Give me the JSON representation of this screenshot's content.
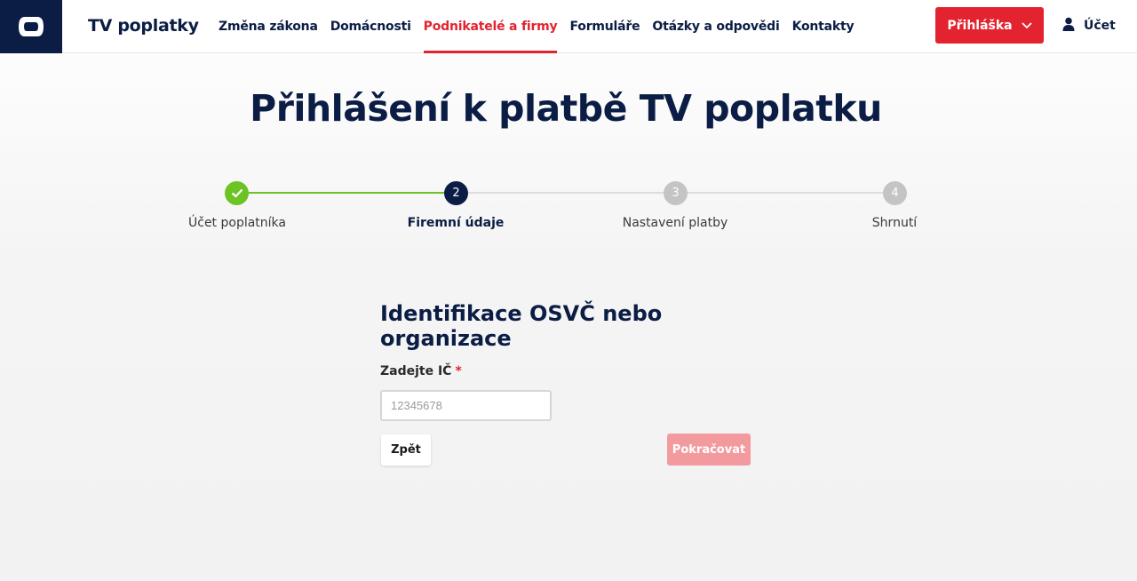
{
  "header": {
    "brand": "TV poplatky",
    "logo_icon": "ct-logo-icon",
    "nav": [
      {
        "label": "Změna zákona",
        "active": false
      },
      {
        "label": "Domácnosti",
        "active": false
      },
      {
        "label": "Podnikatelé a firmy",
        "active": true
      },
      {
        "label": "Formuláře",
        "active": false
      },
      {
        "label": "Otázky a odpovědi",
        "active": false
      },
      {
        "label": "Kontakty",
        "active": false
      }
    ],
    "login_button": "Přihláška",
    "account_label": "Účet"
  },
  "page": {
    "title": "Přihlášení k platbě TV poplatku"
  },
  "stepper": {
    "steps": [
      {
        "number": "",
        "label": "Účet poplatníka",
        "state": "done"
      },
      {
        "number": "2",
        "label": "Firemní údaje",
        "state": "current"
      },
      {
        "number": "3",
        "label": "Nastavení platby",
        "state": "todo"
      },
      {
        "number": "4",
        "label": "Shrnutí",
        "state": "todo"
      }
    ]
  },
  "form": {
    "heading": "Identifikace OSVČ nebo organizace",
    "ic_label": "Zadejte IČ",
    "required_mark": "*",
    "ic_placeholder": "12345678",
    "ic_value": "",
    "back_button": "Zpět",
    "continue_button": "Pokračovat"
  },
  "colors": {
    "navy": "#0b1d45",
    "red": "#e3232f",
    "green": "#6cc324",
    "inactive_gray": "#c4c4c4",
    "disabled_red": "#f39a9f"
  }
}
